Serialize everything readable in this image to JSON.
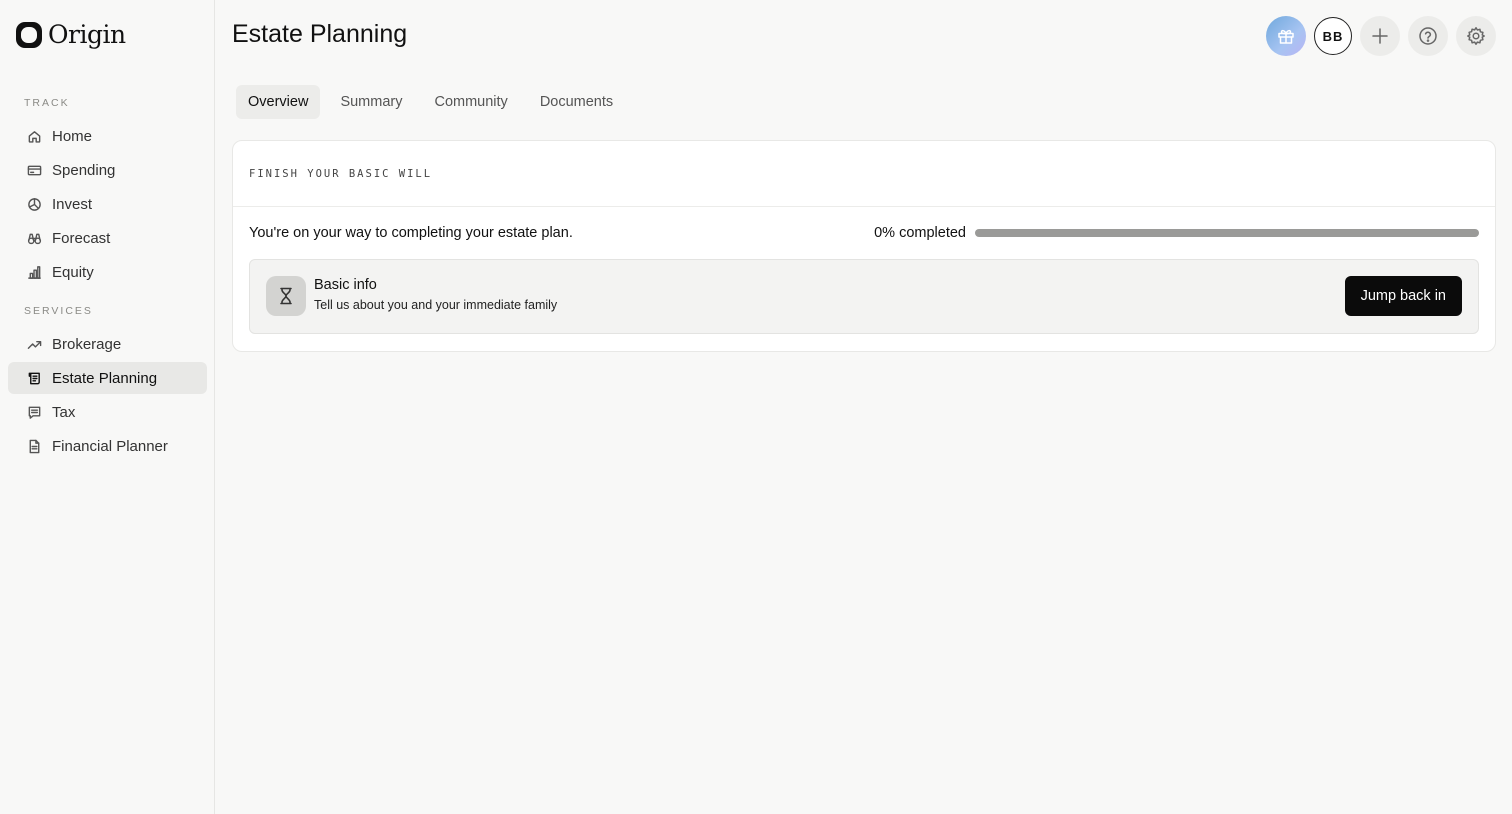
{
  "app": {
    "logo_text": "Origin"
  },
  "sidebar": {
    "sections": [
      {
        "label": "TRACK",
        "items": [
          {
            "label": "Home",
            "icon": "home-icon"
          },
          {
            "label": "Spending",
            "icon": "credit-card-icon"
          },
          {
            "label": "Invest",
            "icon": "pie-chart-icon"
          },
          {
            "label": "Forecast",
            "icon": "binoculars-icon"
          },
          {
            "label": "Equity",
            "icon": "bar-chart-icon"
          }
        ]
      },
      {
        "label": "SERVICES",
        "items": [
          {
            "label": "Brokerage",
            "icon": "trending-up-icon"
          },
          {
            "label": "Estate Planning",
            "icon": "scroll-icon",
            "active": true
          },
          {
            "label": "Tax",
            "icon": "receipt-icon"
          },
          {
            "label": "Financial Planner",
            "icon": "document-icon"
          }
        ]
      }
    ]
  },
  "header": {
    "title": "Estate Planning",
    "avatar_initials": "BB",
    "actions": [
      "gift-icon",
      "avatar",
      "plus-icon",
      "help-icon",
      "gear-icon"
    ]
  },
  "tabs": [
    {
      "label": "Overview",
      "active": true
    },
    {
      "label": "Summary"
    },
    {
      "label": "Community"
    },
    {
      "label": "Documents"
    }
  ],
  "card": {
    "eyebrow": "FINISH YOUR BASIC WILL",
    "message": "You're on your way to completing your estate plan.",
    "progress_text": "0% completed",
    "progress_value": 0,
    "task": {
      "title": "Basic info",
      "subtitle": "Tell us about you and your immediate family",
      "icon": "hourglass-icon",
      "button_label": "Jump back in"
    }
  },
  "colors": {
    "background": "#f8f8f7",
    "active_nav": "#e8e8e6",
    "primary_button": "#0b0b0b",
    "progress_track": "#9a9a98"
  }
}
